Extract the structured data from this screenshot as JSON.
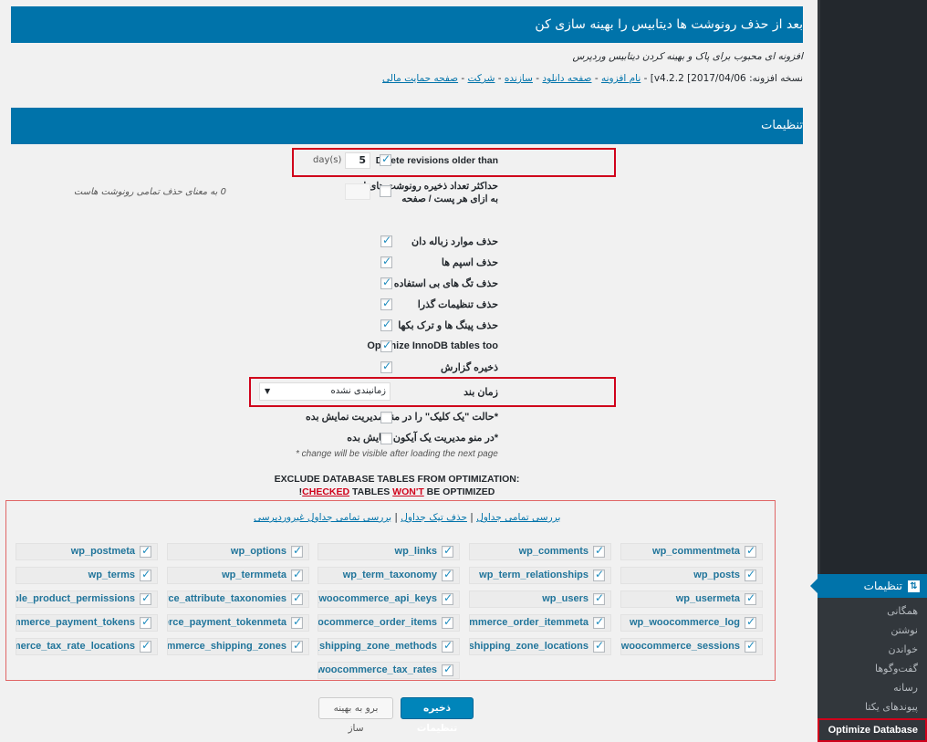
{
  "header": {
    "title": "بعد از حذف رونوشت ها دیتابیس را بهینه سازی کن",
    "subtitle": "افزونه ای محبوب برای پاک و بهینه کردن دیتابیس وردپرس",
    "version_prefix": "نسخه افزونه: 2017/04/06] v4.2.2] - ",
    "links": [
      "نام افزونه",
      "صفحه دانلود",
      "سازنده",
      "شرکت",
      "صفحه حمایت مالی"
    ],
    "link_sep": " - "
  },
  "settings": {
    "section_title": "تنظیمات",
    "delete_revisions": {
      "label": "Delete revisions older than",
      "checked": true,
      "value": "5",
      "unit": "(day(s"
    },
    "max_revisions": {
      "label_line1": "حداکثر تعداد ذخیره رونوشت های اخیر",
      "label_line2": "به ازای هر پست / صفحه",
      "checked": false,
      "value": "",
      "hint": "0 به معنای حذف تمامی رونوشت هاست"
    },
    "options": [
      {
        "label": "حذف موارد زباله دان",
        "checked": true
      },
      {
        "label": "حذف اسپم ها",
        "checked": true
      },
      {
        "label": "حذف تگ های بی استفاده",
        "checked": true
      },
      {
        "label": "حذف تنظیمات گذرا",
        "checked": true
      },
      {
        "label": "حذف پینگ ها و ترک بکها",
        "checked": true
      },
      {
        "label": "Optimize InnoDB tables too",
        "checked": true
      },
      {
        "label": "ذخیره گزارش",
        "checked": true
      }
    ],
    "scheduler": {
      "label": "زمان بند",
      "selected": "زمانبندی نشده",
      "arrow": "▼"
    },
    "one_click": {
      "label": "حالت \"یک کلیک\" را در منو مدیریت نمایش بده*",
      "checked": false
    },
    "admin_icon": {
      "label": "در منو مدیریت یک آیکون نمایش بده*",
      "checked": false
    },
    "note": "* change will be visible after loading the next page"
  },
  "exclude": {
    "title": "EXCLUDE DATABASE TABLES FROM OPTIMIZATION:",
    "warning_prefix": "!",
    "warning_checked": "CHECKED",
    "warning_mid": " TABLES ",
    "warning_wont": "WON'T",
    "warning_suffix": " BE OPTIMIZED",
    "links": [
      "بررسی تمامی جداول",
      "حذف تیک جداول",
      "بررسی تمامی جداول غیروردپرسی"
    ],
    "tables": [
      [
        "wp_commentmeta",
        "wp_comments",
        "wp_links",
        "wp_options",
        "wp_postmeta"
      ],
      [
        "wp_posts",
        "wp_term_relationships",
        "wp_term_taxonomy",
        "wp_termmeta",
        "wp_terms"
      ],
      [
        "wp_usermeta",
        "wp_users",
        "wp_woocommerce_api_keys",
        "wp_woocommerce_attribute_taxonomies",
        "wp_woocommerce_downloadable_product_permissions"
      ],
      [
        "wp_woocommerce_log",
        "wp_woocommerce_order_itemmeta",
        "wp_woocommerce_order_items",
        "wp_woocommerce_payment_tokenmeta",
        "wp_woocommerce_payment_tokens"
      ],
      [
        "wp_woocommerce_sessions",
        "wp_woocommerce_shipping_zone_locations",
        "wp_woocommerce_shipping_zone_methods",
        "wp_woocommerce_shipping_zones",
        "wp_woocommerce_tax_rate_locations"
      ],
      [
        "",
        "",
        "wp_woocommerce_tax_rates",
        "",
        ""
      ]
    ]
  },
  "buttons": {
    "save": "ذخیره تنظیمات",
    "go_optimizer": "برو به بهینه ساز"
  },
  "sidebar": {
    "current": {
      "label": "تنظیمات",
      "icon": "settings-icon"
    },
    "items": [
      "همگانی",
      "نوشتن",
      "خواندن",
      "گفت‌وگوها",
      "رسانه",
      "پیوندهای یکتا",
      "Optimize Database"
    ]
  },
  "colors": {
    "accent": "#0073aa",
    "highlight": "#d0021b",
    "sidebar": "#23282d"
  }
}
